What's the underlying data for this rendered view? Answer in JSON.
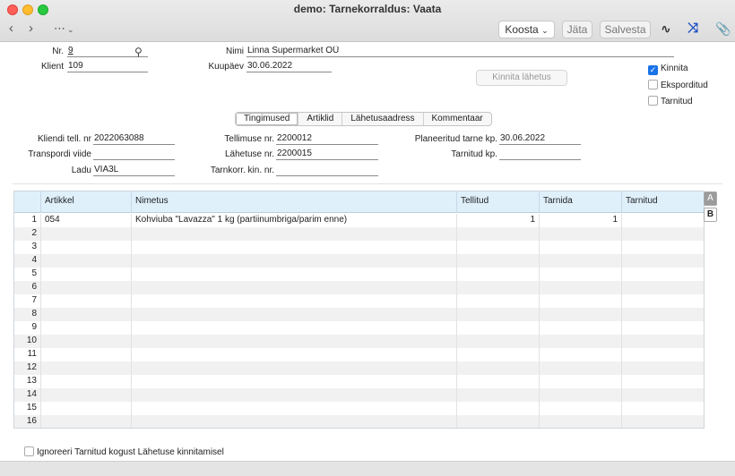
{
  "window": {
    "title": "demo: Tarnekorraldus: Vaata"
  },
  "toolbar": {
    "back_icon": "chevron-left-icon",
    "forward_icon": "chevron-right-icon",
    "more_icon": "ellipsis-circle-icon",
    "koosta_label": "Koosta",
    "jata_label": "Jäta",
    "salvesta_label": "Salvesta",
    "activity_icon": "waveform-icon",
    "expand_icon": "expand-arrows-icon",
    "attach_icon": "paperclip-icon"
  },
  "header": {
    "nr_label": "Nr.",
    "nr_value": "9",
    "klient_label": "Klient",
    "klient_value": "109",
    "nimi_label": "Nimi",
    "nimi_value": "Linna Supermarket OÜ",
    "kuupaev_label": "Kuupäev",
    "kuupaev_value": "30.06.2022",
    "confirm_button": "Kinnita lähetus"
  },
  "flags": {
    "kinnita": {
      "label": "Kinnita",
      "checked": true
    },
    "eksporditud": {
      "label": "Eksporditud",
      "checked": false
    },
    "tarnitud": {
      "label": "Tarnitud",
      "checked": false
    }
  },
  "tabs": [
    "Tingimused",
    "Artiklid",
    "Lähetusaadress",
    "Kommentaar"
  ],
  "terms": {
    "kliendi_tell_label": "Kliendi tell. nr",
    "kliendi_tell_value": "2022063088",
    "transpordi_label": "Transpordi viide",
    "transpordi_value": "",
    "ladu_label": "Ladu",
    "ladu_value": "VIA3L",
    "tellimuse_label": "Tellimuse nr.",
    "tellimuse_value": "2200012",
    "lahetuse_label": "Lähetuse nr.",
    "lahetuse_value": "2200015",
    "tarnkorr_label": "Tarnkorr. kin. nr.",
    "tarnkorr_value": "",
    "planeeritud_label": "Planeeritud tarne kp.",
    "planeeritud_value": "30.06.2022",
    "tarnitud_kp_label": "Tarnitud kp.",
    "tarnitud_kp_value": ""
  },
  "grid": {
    "columns": [
      "",
      "Artikkel",
      "Nimetus",
      "Tellitud",
      "Tarnida",
      "Tarnitud"
    ],
    "rows": [
      [
        "1",
        "054",
        "Kohviuba \"Lavazza\" 1 kg (partiinumbriga/parim enne)",
        "1",
        "1",
        ""
      ],
      [
        "2",
        "",
        "",
        "",
        "",
        ""
      ],
      [
        "3",
        "",
        "",
        "",
        "",
        ""
      ],
      [
        "4",
        "",
        "",
        "",
        "",
        ""
      ],
      [
        "5",
        "",
        "",
        "",
        "",
        ""
      ],
      [
        "6",
        "",
        "",
        "",
        "",
        ""
      ],
      [
        "7",
        "",
        "",
        "",
        "",
        ""
      ],
      [
        "8",
        "",
        "",
        "",
        "",
        ""
      ],
      [
        "9",
        "",
        "",
        "",
        "",
        ""
      ],
      [
        "10",
        "",
        "",
        "",
        "",
        ""
      ],
      [
        "11",
        "",
        "",
        "",
        "",
        ""
      ],
      [
        "12",
        "",
        "",
        "",
        "",
        ""
      ],
      [
        "13",
        "",
        "",
        "",
        "",
        ""
      ],
      [
        "14",
        "",
        "",
        "",
        "",
        ""
      ],
      [
        "15",
        "",
        "",
        "",
        "",
        ""
      ],
      [
        "16",
        "",
        "",
        "",
        "",
        ""
      ]
    ],
    "side_tabs": [
      "A",
      "B"
    ]
  },
  "footer": {
    "ignore_label": "Ignoreeri Tarnitud kogust Lähetuse kinnitamisel",
    "ignore_checked": false
  }
}
